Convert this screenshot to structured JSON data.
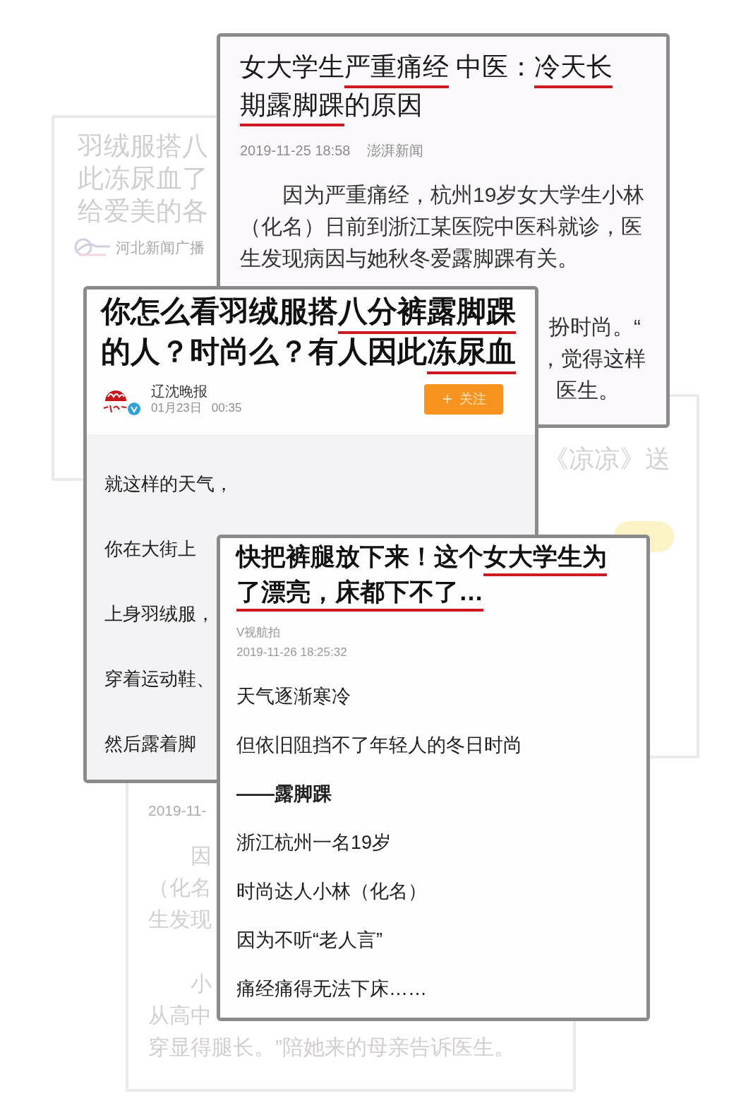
{
  "faded_card_left": {
    "title_lines": [
      "羽绒服搭八",
      "此冻尿血了",
      "给爱美的各"
    ],
    "source": "河北新闻广播"
  },
  "article_top": {
    "title": [
      {
        "text": "女大学生",
        "underlined": false
      },
      {
        "text": "严重痛经",
        "underlined": true
      },
      {
        "text": " 中医：",
        "underlined": false
      },
      {
        "text": "冷天长",
        "underlined": true
      },
      {
        "text": "期露脚踝",
        "underlined": true
      },
      {
        "text": "的原因",
        "underlined": false
      }
    ],
    "date": "2019-11-25 18:58",
    "source": "澎湃新闻",
    "paragraph": "因为严重痛经，杭州19岁女大学生小林（化名）日前到浙江某医院中医科就诊，医生发现病因与她秋冬爱露脚踝有关。",
    "partly_covered_lines": [
      "扮时尚。“",
      "，觉得这样",
      "医生。"
    ]
  },
  "faded_card_right": {
    "text": "《凉凉》送"
  },
  "article_middle": {
    "title": [
      {
        "text": "你怎么看羽绒服搭",
        "underlined": false
      },
      {
        "text": "八分裤露脚踝",
        "underlined": true
      },
      {
        "text": "的人？时尚么？有人因此",
        "underlined": false
      },
      {
        "text": "冻尿血",
        "underlined": true
      }
    ],
    "source": "辽沈晚报",
    "verified": true,
    "date": "01月23日",
    "time": "00:35",
    "follow_button": "关注",
    "lines": [
      "就这样的天气，",
      "你在大街上",
      "上身羽绒服，",
      "穿着运动鞋、",
      "然后露着脚"
    ]
  },
  "article_bottom": {
    "title": [
      {
        "text": "快把裤腿放下来！这个",
        "underlined": false
      },
      {
        "text": "女大学生为",
        "underlined": true
      },
      {
        "text": "了漂亮，床都下不了…",
        "underlined": true
      }
    ],
    "source": "V视航拍",
    "date": "2019-11-26 18:25:32",
    "lines": [
      {
        "text": "天气逐渐寒冷",
        "bold": false
      },
      {
        "text": "但依旧阻挡不了年轻人的冬日时尚",
        "bold": false
      },
      {
        "text": "——露脚踝",
        "bold": true
      },
      {
        "text": "浙江杭州一名19岁",
        "bold": false
      },
      {
        "text": "时尚达人小林（化名）",
        "bold": false
      },
      {
        "text": "因为不听“老人言”",
        "bold": false
      },
      {
        "text": "痛经痛得无法下床……",
        "bold": false
      }
    ]
  },
  "faded_card_bottom": {
    "date": "2019-11-",
    "paragraphs": [
      [
        "因",
        "（化名",
        "生发现"
      ],
      [
        "小",
        "从高中",
        "穿显得腿长。”陪她来的母亲告诉医生。"
      ]
    ]
  }
}
